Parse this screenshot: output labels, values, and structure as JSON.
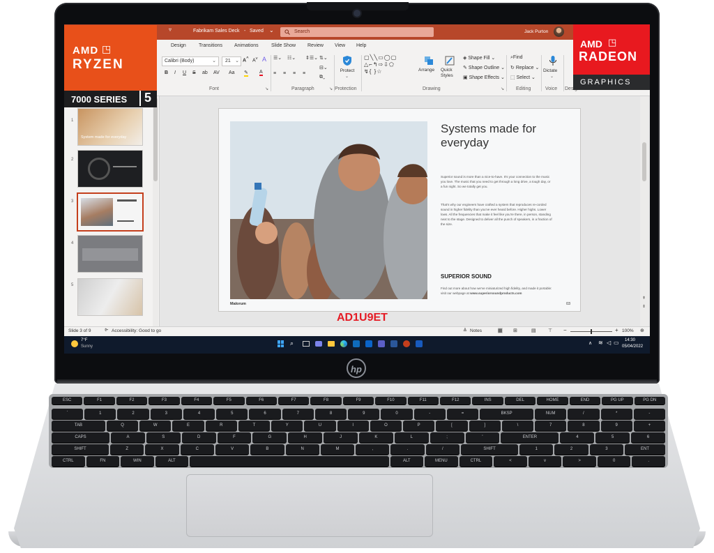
{
  "badges": {
    "left": {
      "brand": "AMD",
      "product": "RYZEN",
      "series": "7000 SERIES",
      "tier": "5"
    },
    "right": {
      "brand": "AMD",
      "product": "RADEON",
      "sub": "GRAPHICS"
    },
    "colors": {
      "amd_orange": "#e8501a",
      "amd_red": "#e8191f"
    }
  },
  "sku": "AD1U9ET",
  "laptop": {
    "logo": "hp"
  },
  "app": {
    "title": "Fabrikam Sales Deck",
    "saved": "Saved",
    "search_placeholder": "Search",
    "user_name": "Jack Purton",
    "accent": "#b7472a"
  },
  "ribbon": {
    "tabs": [
      "Design",
      "Transitions",
      "Animations",
      "Slide Show",
      "Review",
      "View",
      "Help"
    ],
    "font_name": "Calibri (Body)",
    "font_size": "21",
    "groups": [
      "Font",
      "Paragraph",
      "Protection",
      "Drawing",
      "Editing",
      "Voice",
      "Designer"
    ],
    "protect": "Protect",
    "arrange": "Arrange",
    "quick_styles": "Quick Styles",
    "shape_fill": "Shape Fill",
    "shape_outline": "Shape Outline",
    "shape_effects": "Shape Effects",
    "find": "Find",
    "replace": "Replace",
    "select": "Select",
    "dictate": "Dictate"
  },
  "thumbnails": {
    "items": [
      {
        "num": "1",
        "caption": "System made for everyday"
      },
      {
        "num": "2",
        "caption": ""
      },
      {
        "num": "3",
        "caption": ""
      },
      {
        "num": "4",
        "caption": ""
      },
      {
        "num": "5",
        "caption": ""
      }
    ]
  },
  "slide": {
    "title": "Systems made for everyday",
    "para1": "Superior sound is more than a nice-to-have. It's your connection to the music you love. The music that you need to get through a long drive, a tough day, or a fun night. So we totally get you.",
    "para2": "That's why our engineers have crafted a system that reproduces re-corded sound in higher fidelity than you've ever heard before. Higher highs. Lower lows. All the frequencies that make it feel like you're there, in person, standing next to the stage. Designed to deliver all the punch of speakers, in a fraction of the size.",
    "heading": "SUPERIOR SOUND",
    "para3": "Find out more about how we've miniaturized high fidelity, and made it portable: visit our webpage at",
    "url": "www.superiorsoundproducts.com",
    "footer_left": "Malorum",
    "page_num": "03"
  },
  "status": {
    "slide_info": "Slide 3 of 9",
    "accessibility": "Accessibility: Good to go",
    "notes": "Notes",
    "zoom": "100%"
  },
  "taskbar": {
    "weather_temp": "7°F",
    "weather_desc": "Sunny",
    "time": "14:30",
    "date": "05/04/2022"
  },
  "keyboard": {
    "rows": [
      [
        "ESC",
        "F1",
        "F2",
        "F3",
        "F4",
        "F5",
        "F6",
        "F7",
        "F8",
        "F9",
        "F10",
        "F11",
        "F12",
        "INS",
        "DEL",
        "HOME",
        "END",
        "PG UP",
        "PG DN"
      ],
      [
        "`",
        "1",
        "2",
        "3",
        "4",
        "5",
        "6",
        "7",
        "8",
        "9",
        "0",
        "-",
        "=",
        "BKSP",
        "NUM",
        "/",
        "*",
        "-"
      ],
      [
        "TAB",
        "Q",
        "W",
        "E",
        "R",
        "T",
        "Y",
        "U",
        "I",
        "O",
        "P",
        "[",
        "]",
        "\\",
        "7",
        "8",
        "9",
        "+"
      ],
      [
        "CAPS",
        "A",
        "S",
        "D",
        "F",
        "G",
        "H",
        "J",
        "K",
        "L",
        ";",
        "'",
        "ENTER",
        "4",
        "5",
        "6"
      ],
      [
        "SHIFT",
        "Z",
        "X",
        "C",
        "V",
        "B",
        "N",
        "M",
        ",",
        ".",
        "/",
        "SHIFT",
        "1",
        "2",
        "3",
        "ENT"
      ],
      [
        "CTRL",
        "FN",
        "WIN",
        "ALT",
        "",
        "ALT",
        "MENU",
        "CTRL",
        "<",
        "v",
        ">",
        "0",
        "."
      ]
    ]
  }
}
